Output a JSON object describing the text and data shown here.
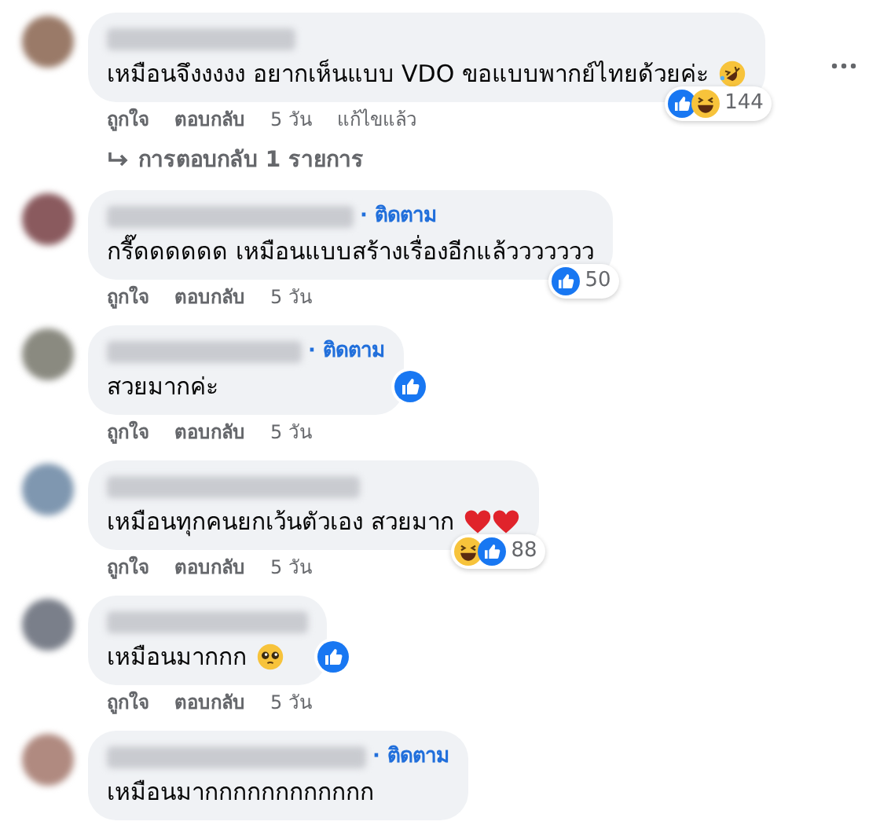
{
  "comments": [
    {
      "text": "เหมือนจึงงงงง อยากเห็นแบบ VDO ขอแบบพากย์ไทยด้วยค่ะ",
      "emojis": [
        {
          "kind": "rofl"
        }
      ],
      "reactions": {
        "icons": [
          {
            "kind": "like"
          },
          {
            "kind": "haha"
          }
        ],
        "count": "144"
      },
      "more_menu": true,
      "actions": [
        "ถูกใจ",
        "ตอบกลับ",
        "5 วัน",
        "แก้ไขแล้ว"
      ],
      "replies_link": "การตอบกลับ 1 รายการ"
    },
    {
      "follow_link": "· ติดตาม",
      "text": "กรี๊ดดดดดด เหมือนแบบสร้างเรื่องอีกแล้ววววววว",
      "reactions": {
        "icons": [
          {
            "kind": "like"
          }
        ],
        "count": "50"
      },
      "actions": [
        "ถูกใจ",
        "ตอบกลับ",
        "5 วัน"
      ]
    },
    {
      "follow_link": "· ติดตาม",
      "text": "สวยมากค่ะ",
      "reactions": {
        "icons": [
          {
            "kind": "like"
          }
        ]
      },
      "actions": [
        "ถูกใจ",
        "ตอบกลับ",
        "5 วัน"
      ]
    },
    {
      "text": "เหมือนทุกคนยกเว้นตัวเอง สวยมาก",
      "emojis": [
        {
          "kind": "heart"
        },
        {
          "kind": "heart"
        }
      ],
      "reactions": {
        "icons": [
          {
            "kind": "haha"
          },
          {
            "kind": "like"
          }
        ],
        "count": "88"
      },
      "actions": [
        "ถูกใจ",
        "ตอบกลับ",
        "5 วัน"
      ]
    },
    {
      "text": "เหมือนมากกก",
      "emojis": [
        {
          "kind": "pleading"
        }
      ],
      "reactions": {
        "icons": [
          {
            "kind": "like"
          }
        ]
      },
      "actions": [
        "ถูกใจ",
        "ตอบกลับ",
        "5 วัน"
      ]
    },
    {
      "follow_link": "· ติดตาม",
      "text": "เหมือนมากกกกกกกกกกกก"
    }
  ]
}
